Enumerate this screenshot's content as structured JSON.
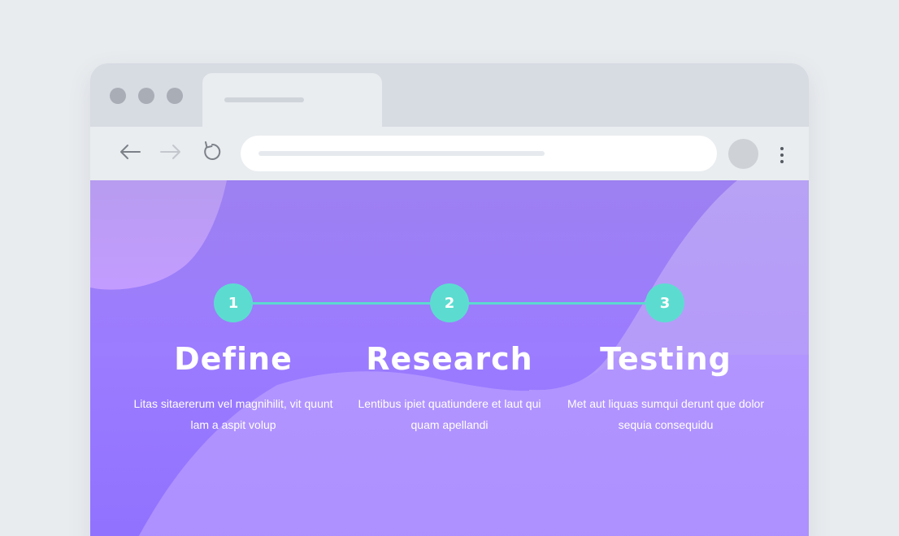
{
  "browser": {
    "window_controls": [
      "close-dot",
      "minimize-dot",
      "maximize-dot"
    ],
    "nav": {
      "back_icon": "arrow-left-icon",
      "forward_icon": "arrow-right-icon",
      "reload_icon": "reload-icon"
    },
    "menu_icon": "more-vertical-icon"
  },
  "colors": {
    "accent_teal": "#5cdcd0",
    "purple_main": "#9b7dff",
    "purple_light": "#b99bff"
  },
  "steps": [
    {
      "number": "1",
      "title": "Define",
      "description": "Litas sitaererum vel magnihilit, vit quunt lam a aspit volup"
    },
    {
      "number": "2",
      "title": "Research",
      "description": "Lentibus ipiet quatiundere et laut qui quam apellandi"
    },
    {
      "number": "3",
      "title": "Testing",
      "description": "Met aut liquas sumqui derunt que dolor sequia consequidu"
    }
  ]
}
